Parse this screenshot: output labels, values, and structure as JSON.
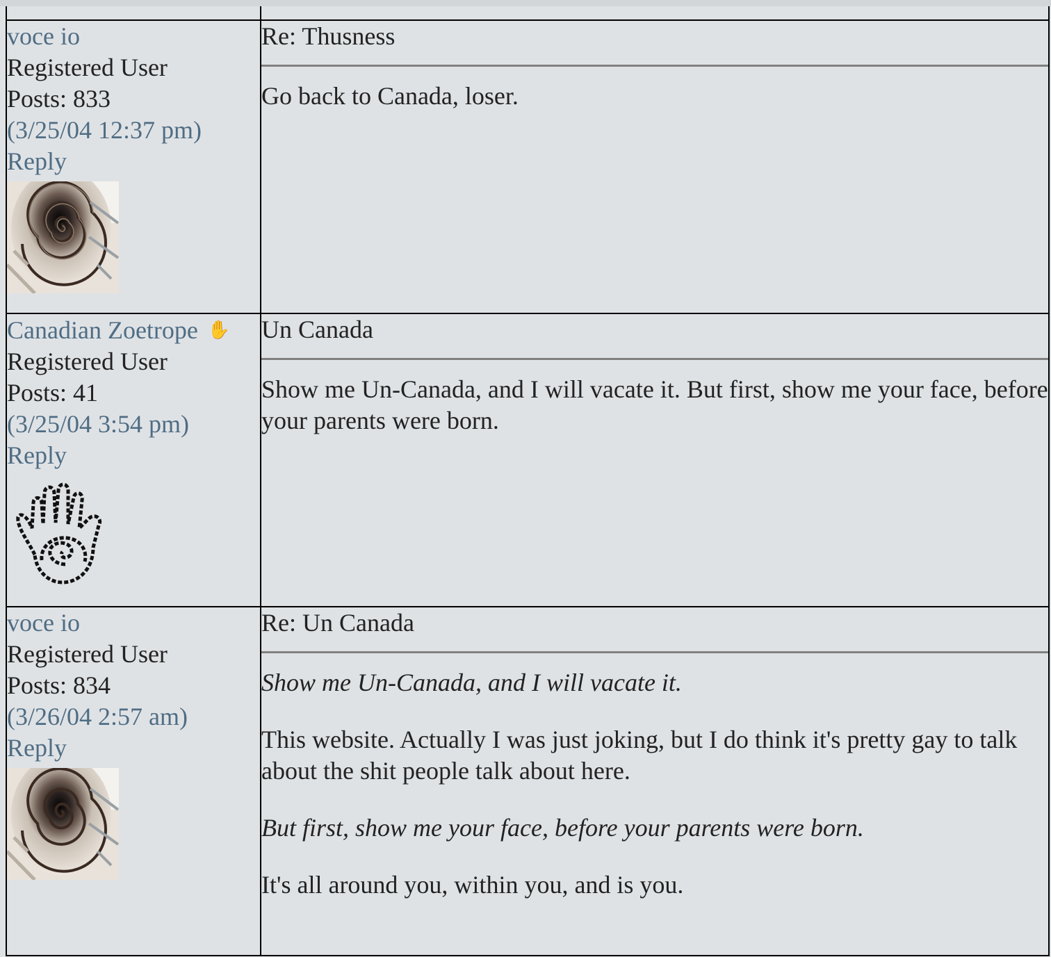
{
  "posts": [
    {
      "username": "voce io",
      "role": "Registered User",
      "posts_count": "Posts: 833",
      "date": "(3/25/04 12:37 pm)",
      "reply_label": "Reply",
      "avatar": "spiral-staircase-avatar",
      "has_badge": false,
      "subject": "Re: Thusness",
      "body": [
        {
          "text": "Go back to Canada, loser.",
          "quote": false
        }
      ]
    },
    {
      "username": "Canadian Zoetrope",
      "role": "Registered User",
      "posts_count": "Posts: 41",
      "date": "(3/25/04 3:54 pm)",
      "reply_label": "Reply",
      "avatar": "spiral-hand-avatar",
      "has_badge": true,
      "badge_icon": "hand-icon",
      "subject": "Un Canada",
      "body": [
        {
          "text": "Show me Un-Canada, and I will vacate it. But first, show me your face, before your parents were born.",
          "quote": false
        }
      ]
    },
    {
      "username": "voce io",
      "role": "Registered User",
      "posts_count": "Posts: 834",
      "date": "(3/26/04 2:57 am)",
      "reply_label": "Reply",
      "avatar": "spiral-staircase-avatar",
      "has_badge": false,
      "subject": "Re: Un Canada",
      "body": [
        {
          "text": "Show me Un-Canada, and I will vacate it.",
          "quote": true
        },
        {
          "text": "This website. Actually I was just joking, but I do think it's pretty gay to talk about the shit people talk about here.",
          "quote": false
        },
        {
          "text": "But first, show me your face, before your parents were born.",
          "quote": true
        },
        {
          "text": "It's all around you, within you, and is you.",
          "quote": false
        }
      ]
    }
  ],
  "colors": {
    "background": "#dfe2e5",
    "link": "#4f6d84",
    "text": "#222222",
    "border": "#000000",
    "rule": "#808080"
  }
}
